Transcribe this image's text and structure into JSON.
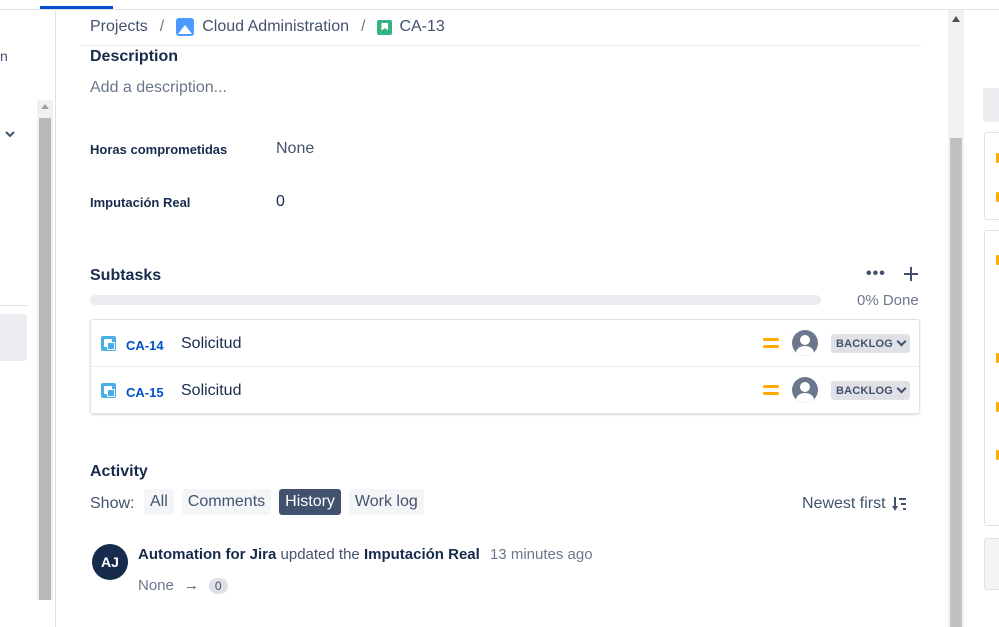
{
  "breadcrumb": {
    "projects": "Projects",
    "separator": "/",
    "project": "Cloud Administration",
    "issue_key": "CA-13"
  },
  "description": {
    "title": "Description",
    "placeholder": "Add a description..."
  },
  "fields": [
    {
      "label": "Horas comprometidas",
      "value": "None"
    },
    {
      "label": "Imputación Real",
      "value": "0"
    }
  ],
  "subtasks": {
    "title": "Subtasks",
    "more_icon": "more-icon",
    "add_icon": "plus-icon",
    "progress_percent": 0,
    "progress_label": "0% Done",
    "items": [
      {
        "key": "CA-14",
        "summary": "Solicitud",
        "priority": "medium",
        "status": "BACKLOG"
      },
      {
        "key": "CA-15",
        "summary": "Solicitud",
        "priority": "medium",
        "status": "BACKLOG"
      }
    ]
  },
  "activity": {
    "title": "Activity",
    "show_label": "Show:",
    "tabs": [
      {
        "label": "All",
        "active": false
      },
      {
        "label": "Comments",
        "active": false
      },
      {
        "label": "History",
        "active": true
      },
      {
        "label": "Work log",
        "active": false
      }
    ],
    "sort_label": "Newest first",
    "history": {
      "avatar_initials": "AJ",
      "actor": "Automation for Jira",
      "verb": "updated the",
      "field": "Imputación Real",
      "time": "13 minutes ago",
      "from": "None",
      "arrow": "→",
      "to": "0"
    }
  },
  "colors": {
    "link": "#0052cc",
    "priority_medium": "#ffab00",
    "active_tab": "#42526e",
    "story": "#36b37e",
    "subtask": "#4bade8"
  }
}
